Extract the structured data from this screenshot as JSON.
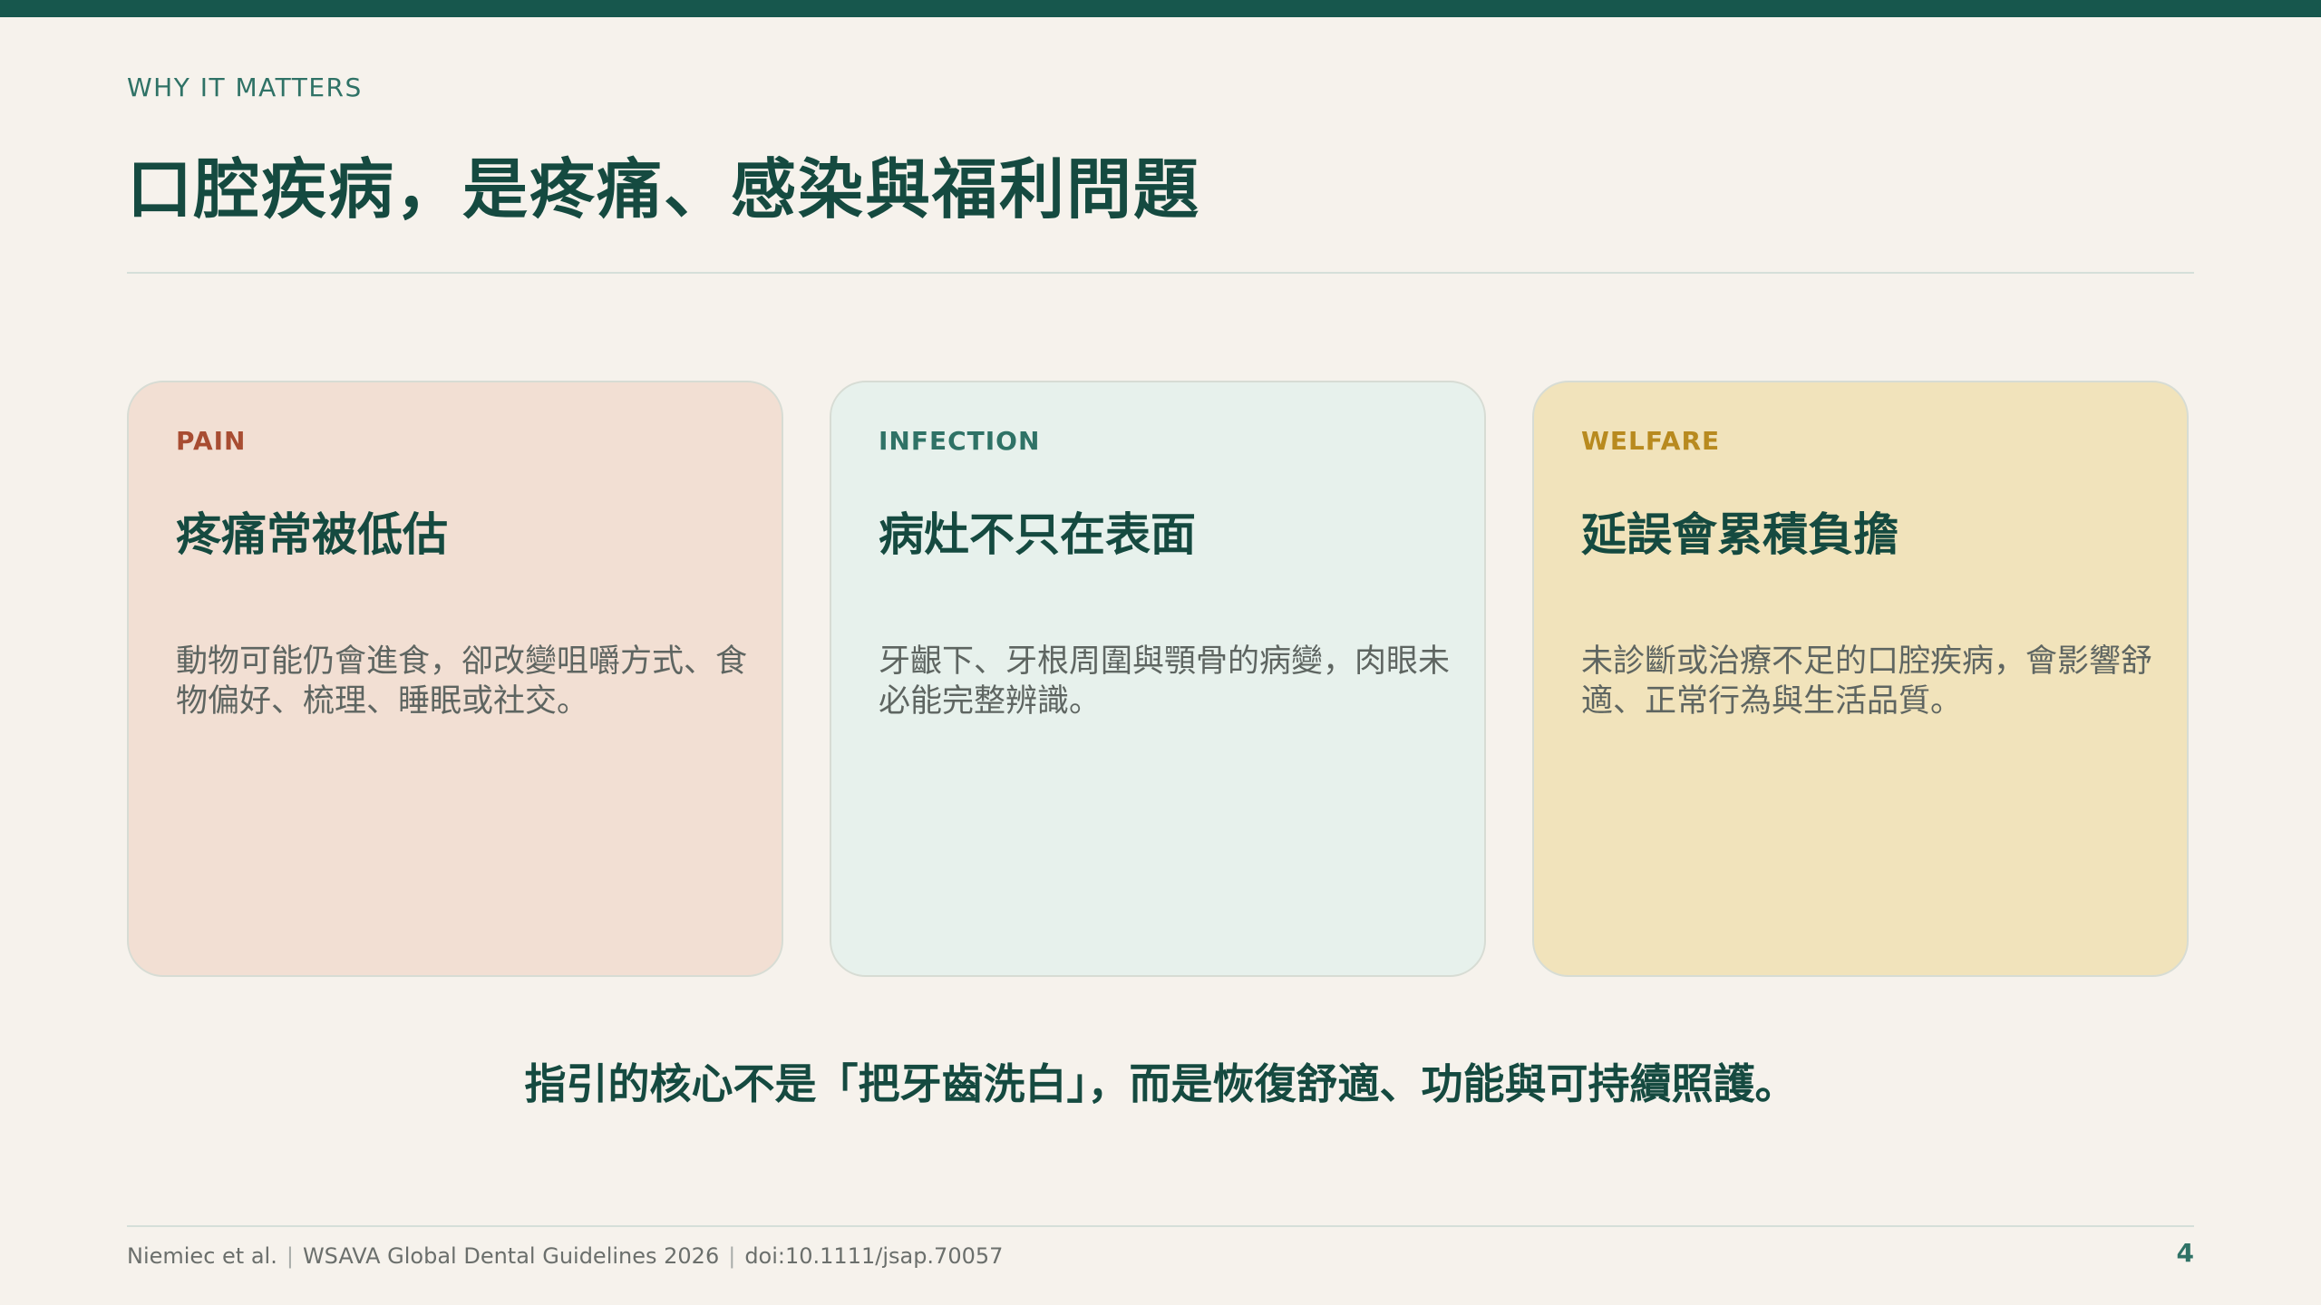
{
  "slide": {
    "eyebrow": "WHY IT MATTERS",
    "title": "口腔疾病，是疼痛、感染與福利問題",
    "cards": [
      {
        "tag": "PAIN",
        "heading": "疼痛常被低估",
        "body": "動物可能仍會進食，卻改變咀嚼方式、食物偏好、梳理、睡眠或社交。"
      },
      {
        "tag": "INFECTION",
        "heading": "病灶不只在表面",
        "body": "牙齦下、牙根周圍與顎骨的病變，肉眼未必能完整辨識。"
      },
      {
        "tag": "WELFARE",
        "heading": "延誤會累積負擔",
        "body": "未診斷或治療不足的口腔疾病，會影響舒適、正常行為與生活品質。"
      }
    ],
    "takeaway": "指引的核心不是「把牙齒洗白」，而是恢復舒適、功能與可持續照護。"
  },
  "footer": {
    "authors": "Niemiec et al.",
    "source": "WSAVA Global Dental Guidelines 2026",
    "doi": "doi:10.1111/jsap.70057",
    "separator": "|",
    "page_number": "4"
  },
  "colors": {
    "accent_dark": "#154a40",
    "accent_teal": "#2f7266",
    "pain_tag": "#a84d32",
    "welfare_tag": "#b88a1f",
    "pain_bg": "#f2dfd3",
    "infection_bg": "#e7f1ec",
    "welfare_bg": "#f1e3bb",
    "page_bg": "#f6f2ec"
  }
}
